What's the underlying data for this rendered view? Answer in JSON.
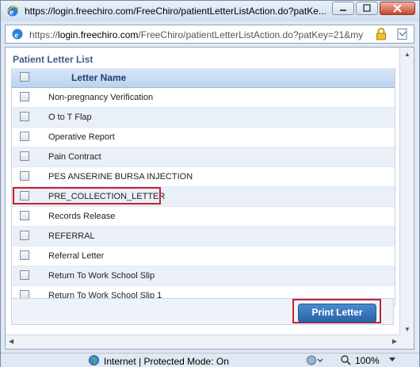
{
  "window": {
    "title": "https://login.freechiro.com/FreeChiro/patientLetterListAction.do?patKe...",
    "address_host": "login.freechiro.com",
    "address_prefix": "https://",
    "address_path": "/FreeChiro/patientLetterListAction.do?patKey=21&my"
  },
  "panel": {
    "title": "Patient Letter List",
    "column_header": "Letter Name",
    "letters": [
      "Non-pregnancy Verification",
      "O to T Flap",
      "Operative Report",
      "Pain Contract",
      "PES ANSERINE BURSA INJECTION",
      "PRE_COLLECTION_LETTER",
      "Records Release",
      "REFERRAL",
      "Referral Letter",
      "Return To Work School Slip",
      "Return To Work School Slip 1"
    ],
    "print_button": "Print Letter"
  },
  "status": {
    "zone": "Internet | Protected Mode: On",
    "zoom": "100%"
  },
  "colors": {
    "highlight": "#cc1f2b",
    "button": "#2a63a8",
    "header_text": "#233f70"
  }
}
